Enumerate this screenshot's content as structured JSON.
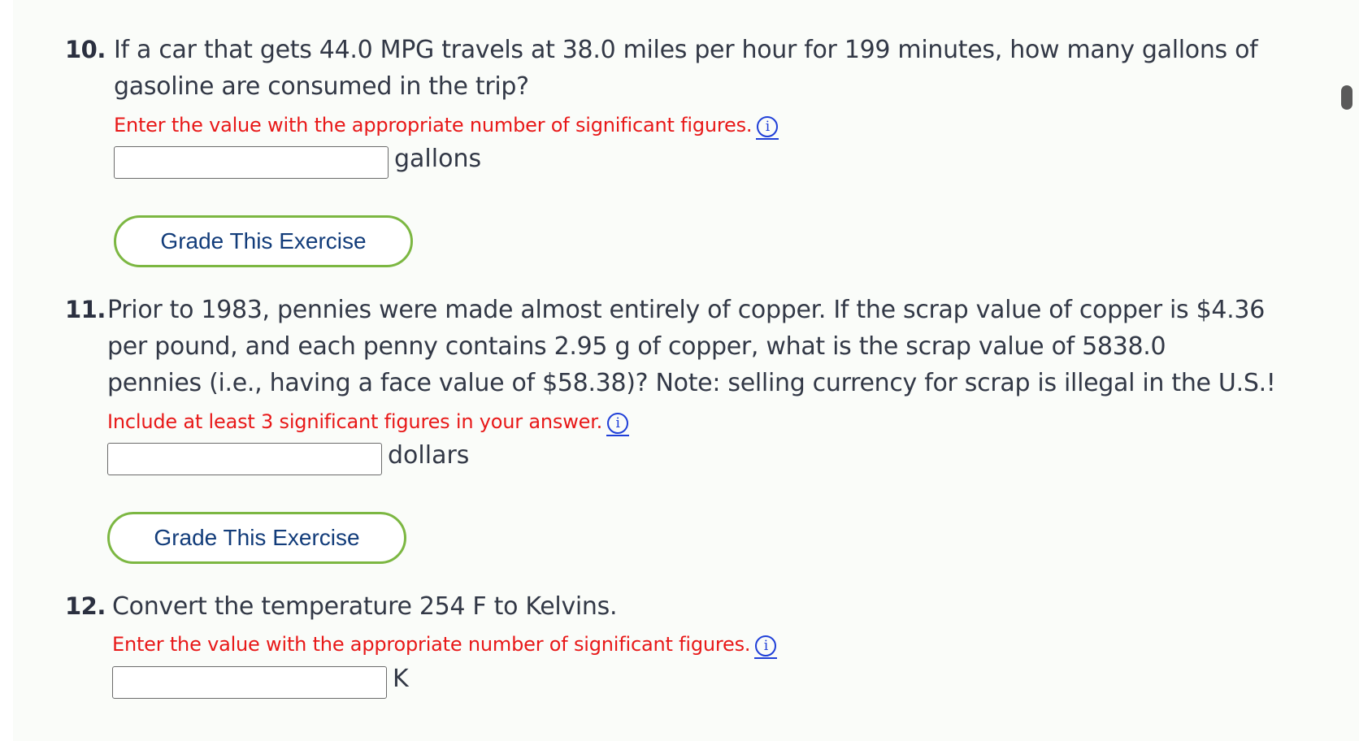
{
  "questions": [
    {
      "number": "10.",
      "text_lines": [
        "If a car that gets 44.0 MPG travels at 38.0 miles per hour for 199 minutes, how many gallons of",
        "gasoline are consumed in the trip?"
      ],
      "hint": "Enter the value with the appropriate number of significant figures.",
      "input_value": "",
      "unit": "gallons",
      "button_label": "Grade This Exercise"
    },
    {
      "number": "11.",
      "text_lines": [
        "Prior to 1983, pennies were made almost entirely of copper. If the scrap value of copper is $4.36",
        "per pound, and each penny contains 2.95 g of copper, what is the scrap value of 5838.0",
        "pennies (i.e., having a face value of $58.38)? Note: selling currency for scrap is illegal in the U.S.!"
      ],
      "hint": "Include at least 3 significant figures in your answer.",
      "input_value": "",
      "unit": "dollars",
      "button_label": "Grade This Exercise"
    },
    {
      "number": "12.",
      "text_lines": [
        "Convert the temperature 254 F to Kelvins."
      ],
      "hint": "Enter the value with the appropriate number of significant figures.",
      "input_value": "",
      "unit": "K"
    }
  ],
  "info_icon_glyph": "i",
  "icons": [
    "info-icon"
  ],
  "colors": {
    "hint_red": "#e81818",
    "button_border_green": "#7cb742",
    "button_text_blue": "#123c7a",
    "info_blue": "#1f3fd8",
    "text_dark": "#323846"
  }
}
